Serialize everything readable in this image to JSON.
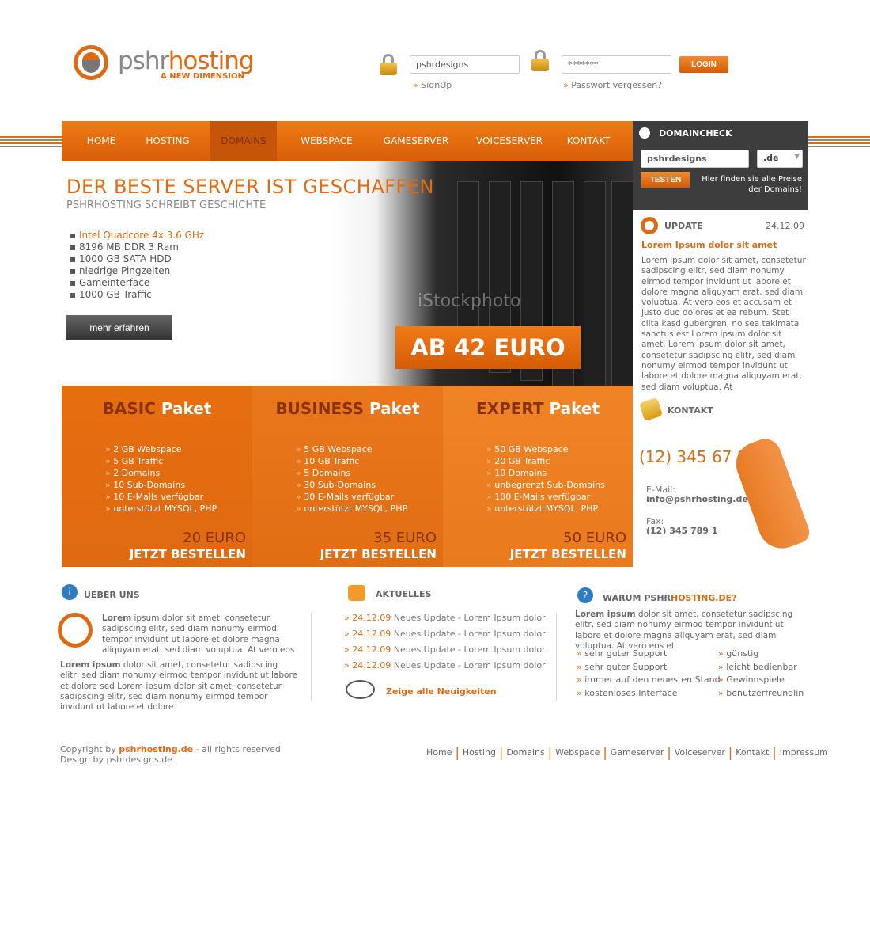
{
  "brand": {
    "name_prefix": "pshr",
    "name_suffix": "hosting",
    "tagline": "A NEW DIMENSION"
  },
  "login": {
    "username_value": "pshrdesigns",
    "password_value": "*******",
    "login_button": "LOGIN",
    "signup": "SignUp",
    "forgot_password": "Passwort vergessen?"
  },
  "nav": [
    "HOME",
    "HOSTING",
    "DOMAINS",
    "WEBSPACE",
    "GAMESERVER",
    "VOICESERVER",
    "KONTAKT"
  ],
  "domaincheck": {
    "title": "DOMAINCHECK",
    "domain_value": "pshrdesigns",
    "tld_value": ".de",
    "test_button": "TESTEN",
    "price_hint": "Hier finden sie alle Preise der Domains!"
  },
  "hero": {
    "title": "DER BESTE SERVER IST GESCHAFFEN",
    "subtitle": "PSHRHOSTING SCHREIBT GESCHICHTE",
    "features": [
      "Intel Quadcore 4x 3.6 GHz",
      "8196 MB DDR 3 Ram",
      "1000 GB SATA HDD",
      "niedrige Pingzeiten",
      "Gameinterface",
      "1000 GB Traffic"
    ],
    "more_button": "mehr erfahren",
    "price": "AB 42 EURO",
    "watermark": "iStockphoto"
  },
  "update": {
    "title": "UPDATE",
    "date": "24.12.09",
    "headline": "Lorem Ipsum dolor sit amet",
    "body": "Lorem ipsum dolor sit amet, consetetur sadipscing elitr, sed diam nonumy eirmod tempor invidunt ut labore et dolore magna aliquyam erat, sed diam voluptua. At vero eos et accusam et justo duo dolores et ea rebum. Stet clita kasd gubergren, no sea takimata sanctus est Lorem ipsum dolor sit amet. Lorem ipsum dolor sit amet, consetetur sadipscing elitr, sed diam nonumy eirmod tempor invidunt ut labore et dolore magna aliquyam erat, sed diam voluptua. At"
  },
  "packages": [
    {
      "kind": "BASIC",
      "word": "Paket",
      "items": [
        "2 GB Webspace",
        "5 GB Traffic",
        "2 Domains",
        "10 Sub-Domains",
        "10 E-Mails verfügbar",
        "unterstützt MYSQL, PHP"
      ],
      "price": "20 EURO",
      "order": "JETZT BESTELLEN"
    },
    {
      "kind": "BUSINESS",
      "word": "Paket",
      "items": [
        "5 GB Webspace",
        "10 GB Traffic",
        "5 Domains",
        "30 Sub-Domains",
        "30 E-Mails verfügbar",
        "unterstützt MYSQL, PHP"
      ],
      "price": "35 EURO",
      "order": "JETZT BESTELLEN"
    },
    {
      "kind": "EXPERT",
      "word": "Paket",
      "items": [
        "50 GB Webspace",
        "20 GB Traffic",
        "10 Domains",
        "unbegrenzt Sub-Domains",
        "100 E-Mails verfügbar",
        "unterstützt MYSQL, PHP"
      ],
      "price": "50 EURO",
      "order": "JETZT BESTELLEN"
    }
  ],
  "contact": {
    "title": "KONTAKT",
    "phone": "(12) 345 67 8",
    "email_label": "E-Mail:",
    "email": "info@pshrhosting.de",
    "fax_label": "Fax:",
    "fax": "(12) 345 789 1"
  },
  "about": {
    "title": "UEBER UNS",
    "lead_bold": "Lorem",
    "lead_text": " ipsum dolor sit amet, consetetur sadipscing elitr, sed diam nonumy eirmod tempor invidunt ut labore et dolore magna aliquyam erat, sed diam voluptua. At vero eos",
    "body_bold": "Lorem ipsum",
    "body_text": " dolor sit amet, consetetur sadipscing elitr, sed diam nonumy eirmod tempor invidunt ut labore et dolore sed Lorem ipsum dolor sit amet, consetetur sadipscing elitr, sed diam nonumy eirmod tempor invidunt ut labore et dolore"
  },
  "news": {
    "title": "AKTUELLES",
    "items": [
      {
        "date": "24.12.09",
        "text": "Neues Update - Lorem Ipsum dolor"
      },
      {
        "date": "24.12.09",
        "text": "Neues Update - Lorem Ipsum dolor"
      },
      {
        "date": "24.12.09",
        "text": "Neues Update - Lorem Ipsum dolor"
      },
      {
        "date": "24.12.09",
        "text": "Neues Update - Lorem Ipsum dolor"
      }
    ],
    "show_all": "Zeige alle Neuigkeiten"
  },
  "why": {
    "title_prefix": "WARUM PSHR",
    "title_suffix": "HOSTING.DE?",
    "lead_bold": "Lorem ipsum",
    "lead_text": " dolor sit amet, consetetur sadipscing elitr, sed diam nonumy eirmod tempor invidunt ut labore et dolore magna aliquyam erat, sed diam voluptua. At vero eos et",
    "left": [
      "sehr guter Support",
      "sehr guter Support",
      "immer auf den neuesten Stand",
      "kostenloses Interface"
    ],
    "right": [
      "günstig",
      "leicht bedienbar",
      "Gewinnspiele",
      "benutzerfreundlin"
    ]
  },
  "footer": {
    "copyright_prefix": "Copyright by ",
    "copyright_site": "pshrhosting.de",
    "copyright_suffix": " - all rights reserved",
    "design": "Design by pshrdesigns.de",
    "links": [
      "Home",
      "Hosting",
      "Domains",
      "Webspace",
      "Gameserver",
      "Voiceserver",
      "Kontakt",
      "Impressum"
    ]
  },
  "colors": {
    "accent": "#e06a12",
    "dark": "#3d3d3d",
    "blue": "#2f7cc0"
  }
}
